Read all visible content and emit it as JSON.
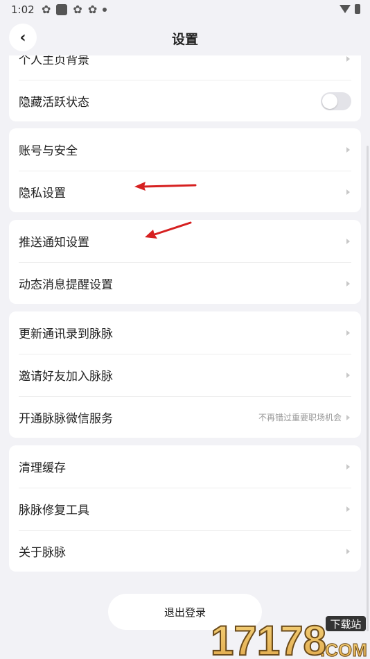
{
  "status": {
    "time": "1:02"
  },
  "header": {
    "title": "设置"
  },
  "card1": {
    "items": [
      {
        "label": "个人主页背景"
      },
      {
        "label": "隐藏活跃状态"
      }
    ]
  },
  "card2": {
    "items": [
      {
        "label": "账号与安全"
      },
      {
        "label": "隐私设置"
      }
    ]
  },
  "card3": {
    "items": [
      {
        "label": "推送通知设置"
      },
      {
        "label": "动态消息提醒设置"
      }
    ]
  },
  "card4": {
    "items": [
      {
        "label": "更新通讯录到脉脉"
      },
      {
        "label": "邀请好友加入脉脉"
      },
      {
        "label": "开通脉脉微信服务",
        "hint": "不再错过重要职场机会"
      }
    ]
  },
  "card5": {
    "items": [
      {
        "label": "清理缓存"
      },
      {
        "label": "脉脉修复工具"
      },
      {
        "label": "关于脉脉"
      }
    ]
  },
  "logout": {
    "label": "退出登录"
  },
  "watermark": {
    "text": "17178",
    "badge": "下载站",
    "domain": ".COM"
  },
  "colors": {
    "background": "#f2f2f6",
    "card": "#ffffff",
    "arrow": "#d62020"
  }
}
